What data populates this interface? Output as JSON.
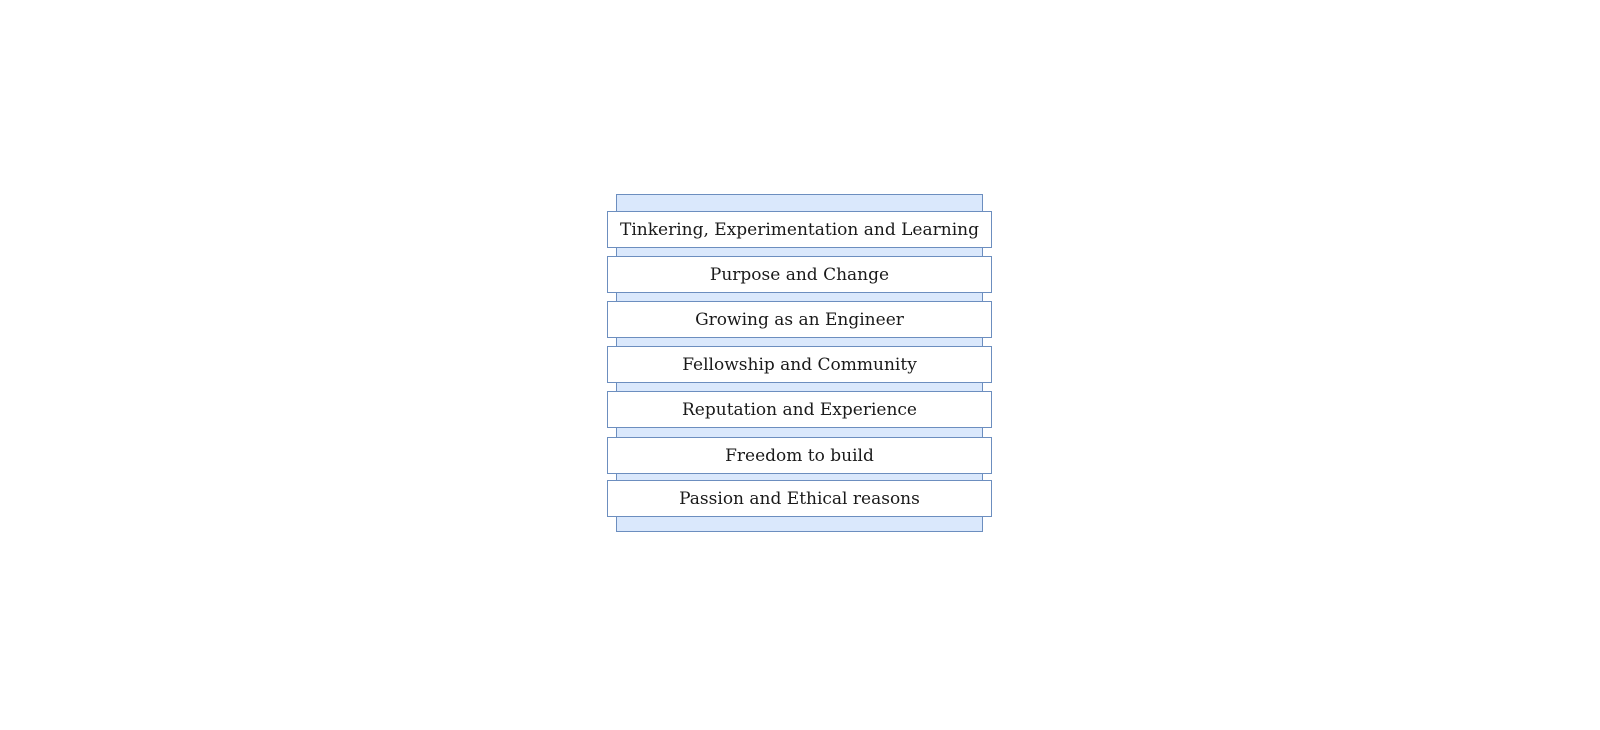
{
  "diagram": {
    "type": "stacked-list",
    "items": [
      {
        "label": "Tinkering, Experimentation and Learning"
      },
      {
        "label": "Purpose and Change"
      },
      {
        "label": "Growing as an Engineer"
      },
      {
        "label": "Fellowship and Community"
      },
      {
        "label": "Reputation and Experience"
      },
      {
        "label": "Freedom to build"
      },
      {
        "label": "Passion and Ethical reasons"
      }
    ],
    "colors": {
      "container_fill": "#dae8fc",
      "border": "#6c8ebf",
      "item_fill": "#ffffff",
      "text": "#1a1a1a"
    }
  }
}
